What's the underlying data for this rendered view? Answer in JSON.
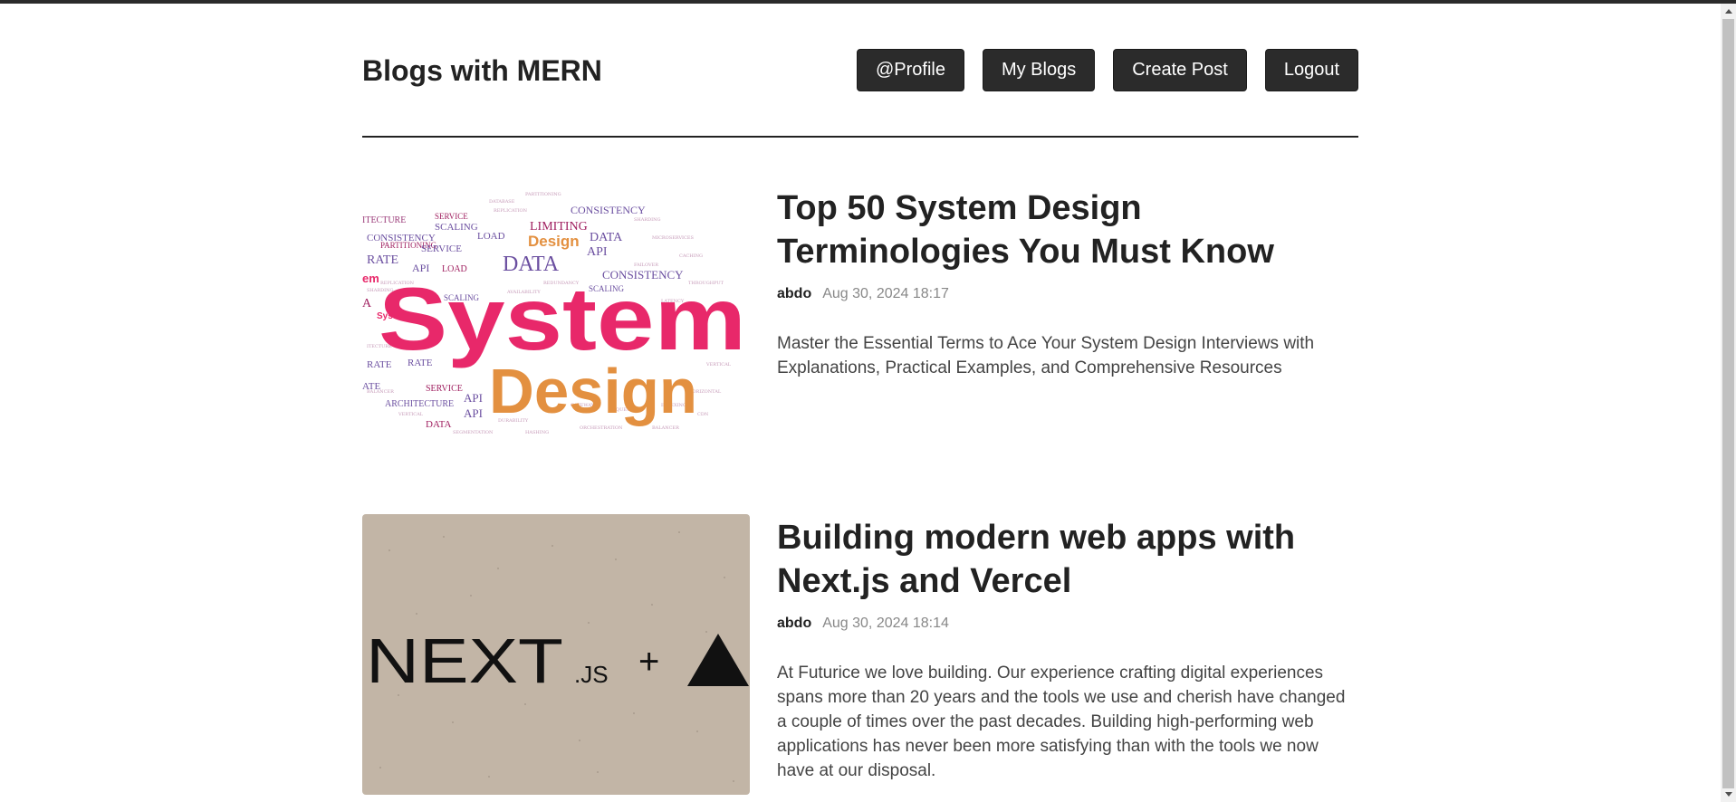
{
  "header": {
    "logo": "Blogs with MERN",
    "nav": [
      "@Profile",
      "My Blogs",
      "Create Post",
      "Logout"
    ]
  },
  "posts": [
    {
      "title": "Top 50 System Design Terminologies You Must Know",
      "author": "abdo",
      "date": "Aug 30, 2024 18:17",
      "summary": "Master the Essential Terms to Ace Your System Design Interviews with Explanations, Practical Examples, and Comprehensive Resources",
      "image": {
        "main_word": "System",
        "second_word": "Design",
        "cloud_words": [
          "Consistency",
          "Limiting",
          "Design",
          "Data",
          "Api",
          "Scaling",
          "Service",
          "Rate",
          "Load",
          "Architecture"
        ]
      }
    },
    {
      "title": "Building modern web apps with Next.js and Vercel",
      "author": "abdo",
      "date": "Aug 30, 2024 18:14",
      "summary": "At Futurice we love building. Our experience crafting digital experiences spans more than 20 years and the tools we use and cherish have changed a couple of times over the past decades. Building high-performing web applications has never been more satisfying than with the tools we now have at our disposal.",
      "image": {
        "logo_text": "NEXT",
        "logo_suffix": ".JS",
        "plus": "+"
      }
    }
  ],
  "colors": {
    "button_bg": "#2b2b2b",
    "pink": "#e8286a",
    "orange": "#e39040",
    "purple": "#6b4fa0",
    "next_bg": "#c2b5a6"
  }
}
